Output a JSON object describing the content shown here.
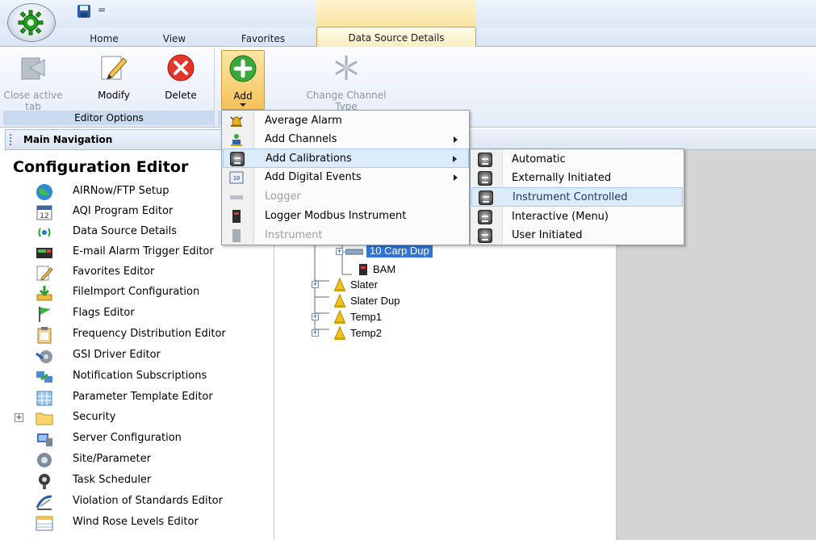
{
  "qat": {
    "dropdown_glyph": "="
  },
  "tabs": [
    {
      "label": "Home"
    },
    {
      "label": "View"
    },
    {
      "label": "Favorites"
    },
    {
      "label": "Data Source Details"
    }
  ],
  "ribbon": {
    "close_label": "Close active tab",
    "modify_label": "Modify",
    "delete_label": "Delete",
    "add_label": "Add",
    "change_label": "Change Channel Type",
    "editor_group_label": "Editor Options"
  },
  "nav": {
    "header": "Main Navigation",
    "title": "Configuration Editor",
    "items": [
      {
        "label": "AIRNow/FTP Setup",
        "icon": "globe-icon"
      },
      {
        "label": "AQI Program Editor",
        "icon": "calendar-icon"
      },
      {
        "label": "Data Source Details",
        "icon": "signal-icon"
      },
      {
        "label": "E-mail Alarm Trigger Editor",
        "icon": "email-alarm-icon"
      },
      {
        "label": "Favorites Editor",
        "icon": "pencil-icon"
      },
      {
        "label": "FileImport Configuration",
        "icon": "import-arrow-icon"
      },
      {
        "label": "Flags Editor",
        "icon": "flag-icon"
      },
      {
        "label": "Frequency Distribution Editor",
        "icon": "clipboard-icon"
      },
      {
        "label": "GSI Driver Editor",
        "icon": "driver-icon"
      },
      {
        "label": "Notification Subscriptions",
        "icon": "notification-icon"
      },
      {
        "label": "Parameter Template Editor",
        "icon": "template-icon"
      },
      {
        "label": "Security",
        "icon": "folder-icon"
      },
      {
        "label": "Server Configuration",
        "icon": "server-icon"
      },
      {
        "label": "Site/Parameter",
        "icon": "site-gear-icon"
      },
      {
        "label": "Task Scheduler",
        "icon": "scheduler-icon"
      },
      {
        "label": "Violation of Standards Editor",
        "icon": "violation-icon"
      },
      {
        "label": "Wind Rose Levels Editor",
        "icon": "windrose-icon"
      }
    ]
  },
  "tree": {
    "nodes": [
      {
        "label": "10 Carp Dup",
        "selected": true
      },
      {
        "label": "BAM"
      },
      {
        "label": "Slater"
      },
      {
        "label": "Slater Dup"
      },
      {
        "label": "Temp1"
      },
      {
        "label": "Temp2"
      }
    ]
  },
  "menu": {
    "items": [
      {
        "label": "Average Alarm",
        "disabled": false,
        "submenu": false
      },
      {
        "label": "Add Channels",
        "disabled": false,
        "submenu": true
      },
      {
        "label": "Add Calibrations",
        "disabled": false,
        "submenu": true,
        "highlighted": true
      },
      {
        "label": "Add Digital Events",
        "disabled": false,
        "submenu": true
      },
      {
        "label": "Logger",
        "disabled": true,
        "submenu": false
      },
      {
        "label": "Logger Modbus Instrument",
        "disabled": false,
        "submenu": false
      },
      {
        "label": "Instrument",
        "disabled": true,
        "submenu": false
      }
    ]
  },
  "submenu": {
    "items": [
      {
        "label": "Automatic"
      },
      {
        "label": "Externally Initiated"
      },
      {
        "label": "Instrument Controlled",
        "highlighted": true
      },
      {
        "label": "Interactive (Menu)"
      },
      {
        "label": "User Initiated"
      }
    ]
  },
  "colors": {
    "context_tab": "#f9e3a2",
    "menu_highlight": "#dcebfa",
    "tree_selection": "#3175d4",
    "right_panel": "#d4d4d4"
  }
}
